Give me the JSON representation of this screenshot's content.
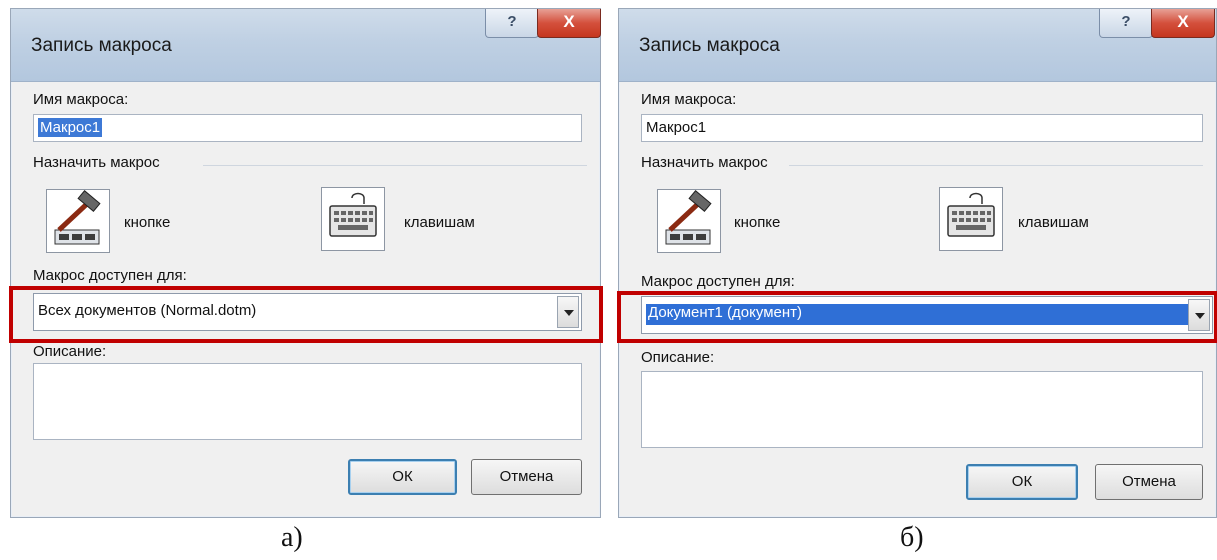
{
  "dialogs": [
    {
      "title": "Запись макроса",
      "help_label": "?",
      "close_label": "X",
      "name_label": "Имя макроса:",
      "name_value": "Макрос1",
      "assign_label": "Назначить макрос",
      "button_option": "кнопке",
      "keys_option": "клавишам",
      "available_label": "Макрос доступен для:",
      "available_value": "Всех документов (Normal.dotm)",
      "description_label": "Описание:",
      "ok_label": "ОК",
      "cancel_label": "Отмена",
      "caption": "а)"
    },
    {
      "title": "Запись макроса",
      "help_label": "?",
      "close_label": "X",
      "name_label": "Имя макроса:",
      "name_value": "Макрос1",
      "assign_label": "Назначить макрос",
      "button_option": "кнопке",
      "keys_option": "клавишам",
      "available_label": "Макрос доступен для:",
      "available_value": "Документ1 (документ)",
      "description_label": "Описание:",
      "ok_label": "ОК",
      "cancel_label": "Отмена",
      "caption": "б)"
    }
  ],
  "colors": {
    "highlight_frame": "#c00000",
    "selection": "#2f6fd6",
    "close_button": "#c5361f"
  }
}
